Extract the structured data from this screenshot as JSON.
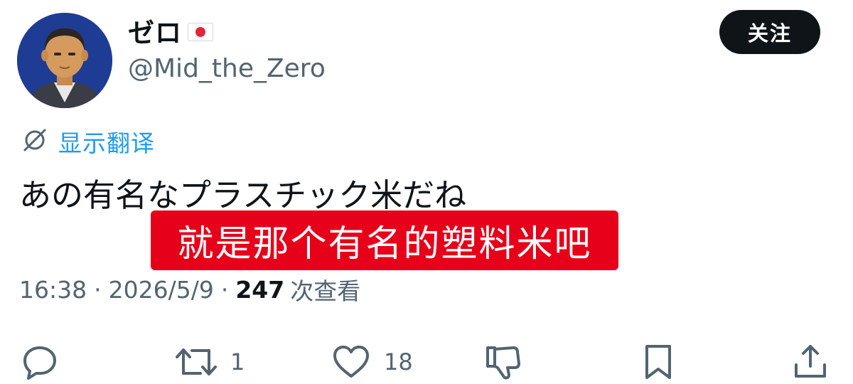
{
  "tweet": {
    "display_name": "ゼロ",
    "flag_icon": "japan-flag-icon",
    "handle": "@Mid_the_Zero",
    "follow_label": "关注",
    "translate_label": "显示翻译",
    "text": "あの有名なプラスチック米だね",
    "caption": "就是那个有名的塑料米吧",
    "time": "16:38",
    "separator": "·",
    "date": "2026/5/9",
    "views_count": "247",
    "views_label": "次查看"
  },
  "actions": {
    "reply_icon": "reply-icon",
    "retweet_icon": "retweet-icon",
    "retweet_count": "1",
    "like_icon": "heart-icon",
    "like_count": "18",
    "dislike_icon": "thumbs-down-icon",
    "bookmark_icon": "bookmark-icon",
    "share_icon": "share-icon"
  },
  "colors": {
    "text": "#0f1419",
    "secondary": "#536471",
    "link": "#1d9bf0",
    "caption_bg": "#e6001a",
    "follow_bg": "#0f1419"
  }
}
